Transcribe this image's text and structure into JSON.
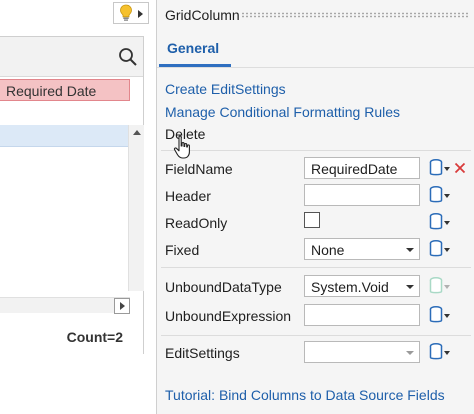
{
  "grid": {
    "column_header": "Required Date",
    "footer_count": "Count=2"
  },
  "panel": {
    "title": "GridColumn",
    "tab": "General",
    "actions": {
      "create_edit_settings": "Create EditSettings",
      "manage_conditional_formatting": "Manage Conditional Formatting Rules",
      "delete": "Delete"
    },
    "properties": {
      "field_name": {
        "label": "FieldName",
        "value": "RequiredDate"
      },
      "header": {
        "label": "Header",
        "value": ""
      },
      "read_only": {
        "label": "ReadOnly",
        "checked": false
      },
      "fixed": {
        "label": "Fixed",
        "value": "None"
      },
      "unbound_data_type": {
        "label": "UnboundDataType",
        "value": "System.Void"
      },
      "unbound_expression": {
        "label": "UnboundExpression",
        "value": ""
      },
      "edit_settings": {
        "label": "EditSettings",
        "value": ""
      }
    },
    "tutorial_link": "Tutorial: Bind Columns to Data Source Fields"
  },
  "colors": {
    "link": "#1e5faa",
    "column_header_bg": "#f4c2c4",
    "selected_row_bg": "#dce9f7",
    "database_icon": "#2b6cb8",
    "delete_icon": "#d93a3a"
  },
  "icons": [
    "lightbulb-icon",
    "search-icon",
    "database-icon",
    "delete-x-icon",
    "hand-cursor-icon"
  ]
}
